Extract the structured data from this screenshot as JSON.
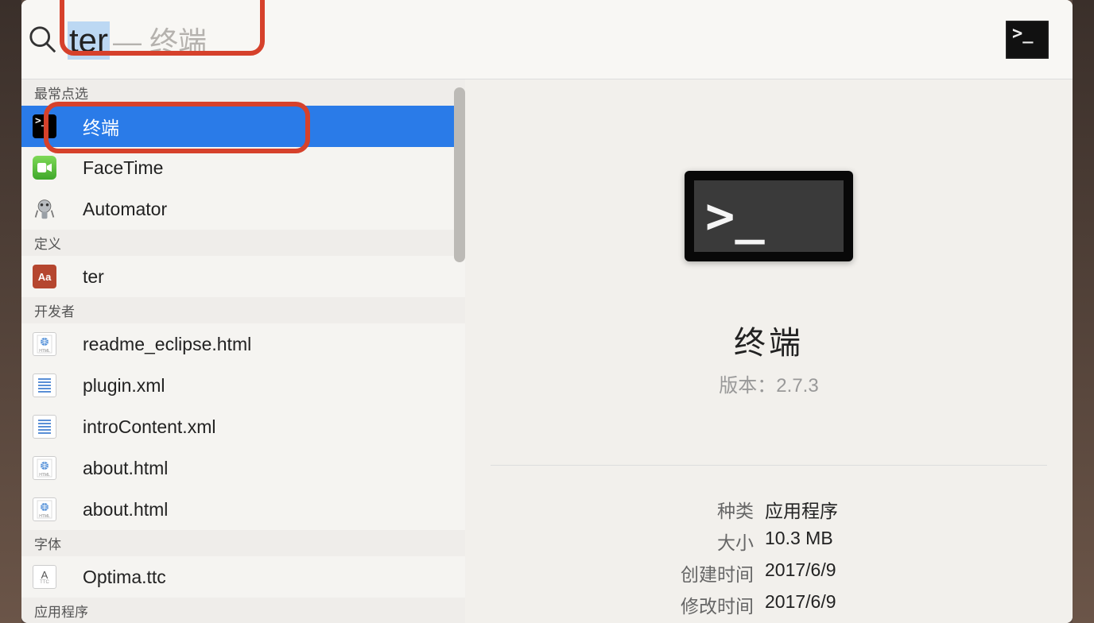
{
  "search": {
    "query": "ter",
    "completion": "— 终端"
  },
  "sections": [
    {
      "title": "最常点选",
      "items": [
        {
          "icon": "terminal",
          "label": "终端",
          "selected": true
        },
        {
          "icon": "facetime",
          "label": "FaceTime"
        },
        {
          "icon": "automator",
          "label": "Automator"
        }
      ]
    },
    {
      "title": "定义",
      "items": [
        {
          "icon": "dictionary",
          "label": "ter"
        }
      ]
    },
    {
      "title": "开发者",
      "items": [
        {
          "icon": "html",
          "label": "readme_eclipse.html"
        },
        {
          "icon": "xml",
          "label": "plugin.xml"
        },
        {
          "icon": "xml",
          "label": "introContent.xml"
        },
        {
          "icon": "html",
          "label": "about.html"
        },
        {
          "icon": "html",
          "label": "about.html"
        }
      ]
    },
    {
      "title": "字体",
      "items": [
        {
          "icon": "ttc",
          "label": "Optima.ttc"
        }
      ]
    },
    {
      "title": "应用程序",
      "items": []
    }
  ],
  "preview": {
    "title": "终端",
    "version_label": "版本：",
    "version": "2.7.3",
    "meta": [
      {
        "label": "种类",
        "value": "应用程序"
      },
      {
        "label": "大小",
        "value": "10.3 MB"
      },
      {
        "label": "创建时间",
        "value": "2017/6/9"
      },
      {
        "label": "修改时间",
        "value": "2017/6/9"
      }
    ]
  }
}
